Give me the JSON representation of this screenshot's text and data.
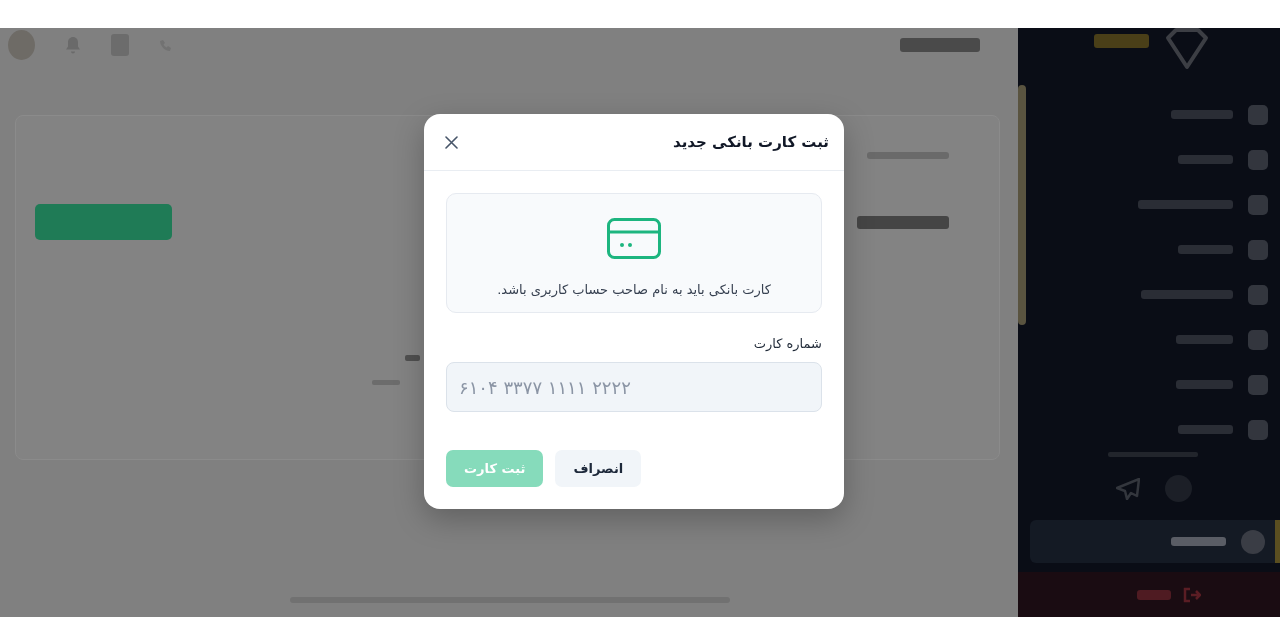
{
  "dialog": {
    "title": "ثبت کارت بانکی جدید",
    "info_text": "کارت بانکی باید به نام صاحب حساب کاربری باشد.",
    "field": {
      "label": "شماره کارت",
      "placeholder": "۶۱۰۴ ۳۳۷۷ ۱۱۱۱ ۲۲۲۲"
    },
    "buttons": [
      {
        "kind": "secondary",
        "label": "انصراف",
        "disabled": false
      },
      {
        "kind": "primary",
        "label": "ثبت کارت",
        "disabled": true
      }
    ]
  },
  "backdrop": {
    "menu_items": [
      {
        "selected": false
      },
      {
        "selected": false
      },
      {
        "selected": false
      },
      {
        "selected": false
      },
      {
        "selected": false
      },
      {
        "selected": false
      },
      {
        "selected": false
      },
      {
        "selected": false
      }
    ],
    "bottom_items": [
      {
        "kind": "link",
        "selected": true
      },
      {
        "kind": "logout",
        "selected": false
      }
    ]
  }
}
